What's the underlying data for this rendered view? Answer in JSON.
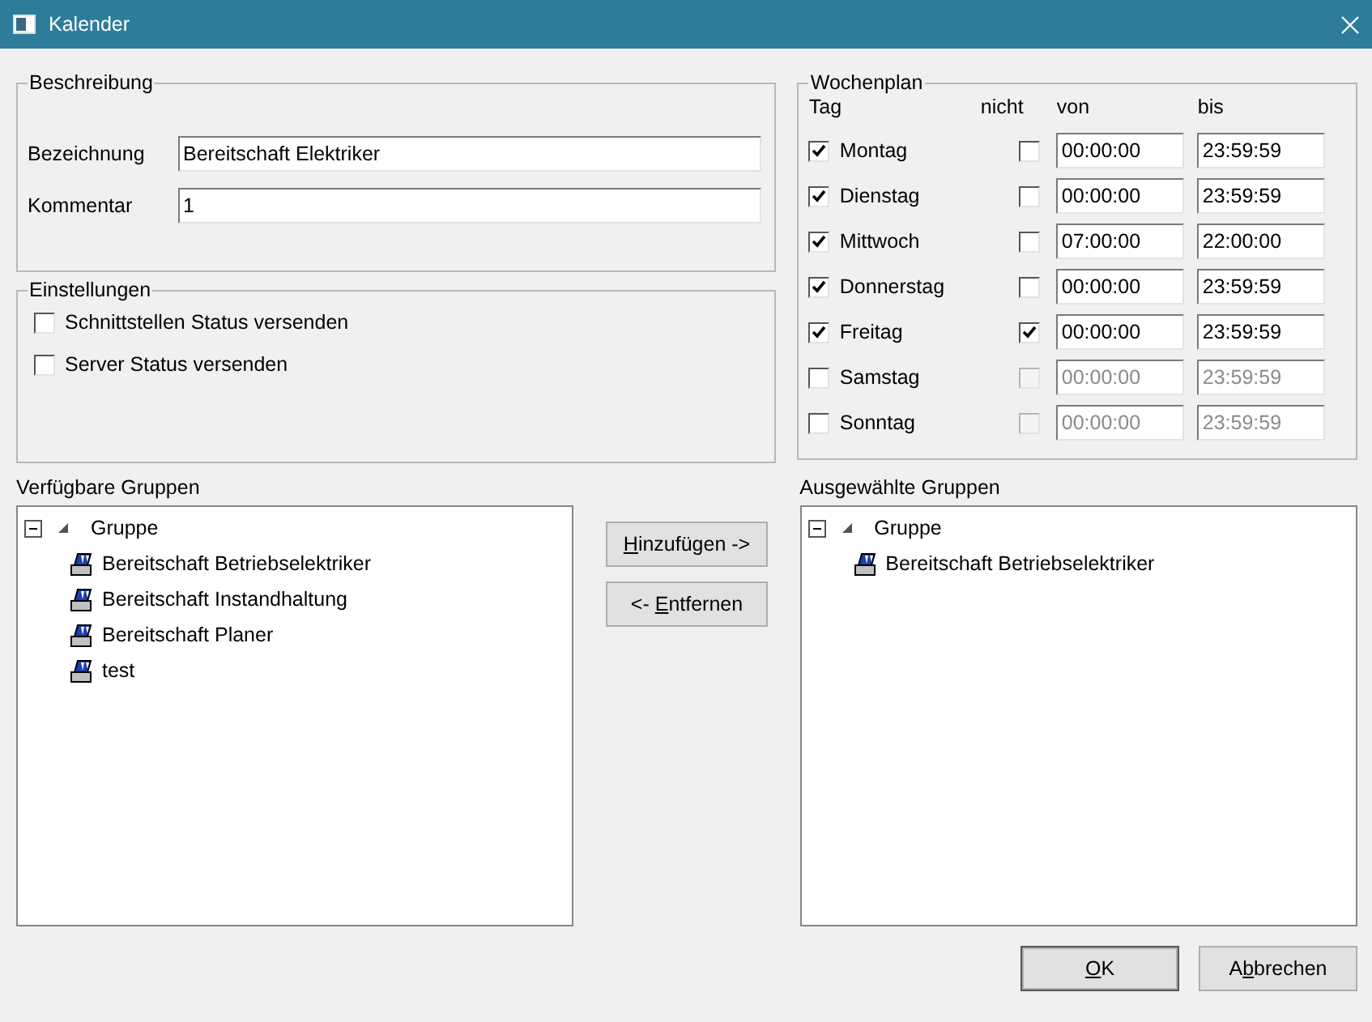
{
  "window": {
    "title": "Kalender"
  },
  "beschreibung": {
    "legend": "Beschreibung",
    "fields": [
      {
        "label": "Bezeichnung",
        "value": "Bereitschaft Elektriker"
      },
      {
        "label": "Kommentar",
        "value": "1"
      }
    ]
  },
  "einstellungen": {
    "legend": "Einstellungen",
    "options": [
      {
        "label": "Schnittstellen Status versenden",
        "checked": false
      },
      {
        "label": "Server Status versenden",
        "checked": false
      }
    ]
  },
  "wochenplan": {
    "legend": "Wochenplan",
    "columns": [
      "Tag",
      "nicht",
      "von",
      "bis"
    ],
    "days": [
      {
        "name": "Montag",
        "checked": true,
        "nicht": false,
        "von": "00:00:00",
        "bis": "23:59:59"
      },
      {
        "name": "Dienstag",
        "checked": true,
        "nicht": false,
        "von": "00:00:00",
        "bis": "23:59:59"
      },
      {
        "name": "Mittwoch",
        "checked": true,
        "nicht": false,
        "von": "07:00:00",
        "bis": "22:00:00"
      },
      {
        "name": "Donnerstag",
        "checked": true,
        "nicht": false,
        "von": "00:00:00",
        "bis": "23:59:59"
      },
      {
        "name": "Freitag",
        "checked": true,
        "nicht": true,
        "von": "00:00:00",
        "bis": "23:59:59"
      },
      {
        "name": "Samstag",
        "checked": false,
        "nicht": false,
        "von": "00:00:00",
        "bis": "23:59:59"
      },
      {
        "name": "Sonntag",
        "checked": false,
        "nicht": false,
        "von": "00:00:00",
        "bis": "23:59:59"
      }
    ]
  },
  "available_groups": {
    "title": "Verfügbare Gruppen",
    "tree": [
      {
        "label": "Gruppe",
        "expanded": true,
        "children": [
          {
            "label": "Bereitschaft Betriebselektriker"
          },
          {
            "label": "Bereitschaft Instandhaltung"
          },
          {
            "label": "Bereitschaft Planer"
          },
          {
            "label": "test"
          }
        ]
      }
    ]
  },
  "transfer_buttons": [
    {
      "access_key": "H",
      "label_after": "inzufügen ->"
    },
    {
      "label_before": "<- ",
      "access_key": "E",
      "label_after": "ntfernen"
    }
  ],
  "selected_groups": {
    "title": "Ausgewählte Gruppen",
    "tree": [
      {
        "label": "Gruppe",
        "expanded": true,
        "children": [
          {
            "label": "Bereitschaft Betriebselektriker"
          }
        ]
      }
    ]
  },
  "dialog_buttons": [
    {
      "access_key": "O",
      "label_after": "K",
      "default": true
    },
    {
      "label_before": "A",
      "access_key": "b",
      "label_after": "brechen",
      "default": false
    }
  ]
}
